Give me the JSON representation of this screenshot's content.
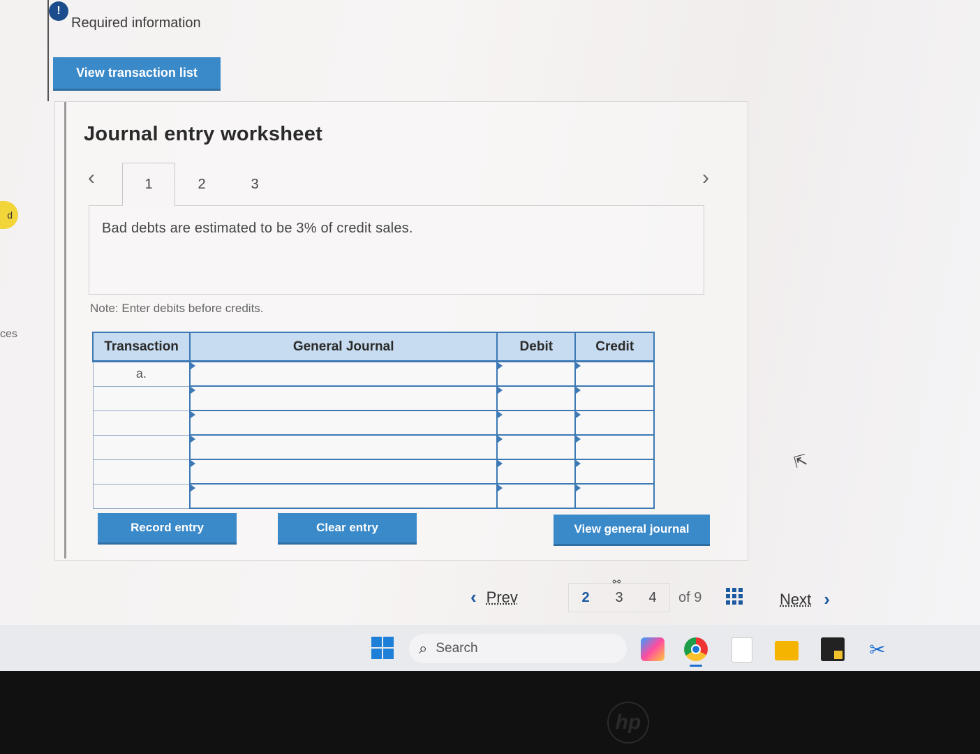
{
  "header": {
    "required_icon": "!",
    "required_text": "Required information",
    "view_transaction_list": "View transaction list"
  },
  "left_edge": {
    "badge": "d",
    "text": "ces"
  },
  "worksheet": {
    "title": "Journal entry worksheet",
    "tabs": [
      {
        "label": "1",
        "active": true
      },
      {
        "label": "2",
        "active": false
      },
      {
        "label": "3",
        "active": false
      }
    ],
    "description": "Bad debts are estimated to be 3% of credit sales.",
    "note": "Note: Enter debits before credits."
  },
  "journal": {
    "headers": [
      "Transaction",
      "General Journal",
      "Debit",
      "Credit"
    ],
    "rows": [
      {
        "transaction": "a.",
        "account": "",
        "debit": "",
        "credit": ""
      },
      {
        "transaction": "",
        "account": "",
        "debit": "",
        "credit": ""
      },
      {
        "transaction": "",
        "account": "",
        "debit": "",
        "credit": ""
      },
      {
        "transaction": "",
        "account": "",
        "debit": "",
        "credit": ""
      },
      {
        "transaction": "",
        "account": "",
        "debit": "",
        "credit": ""
      },
      {
        "transaction": "",
        "account": "",
        "debit": "",
        "credit": ""
      }
    ]
  },
  "actions": {
    "record": "Record entry",
    "clear": "Clear entry",
    "view_journal": "View general journal"
  },
  "pager": {
    "prev": "Prev",
    "pages": [
      "2",
      "3",
      "4"
    ],
    "current": "2",
    "of_total": "of 9",
    "next": "Next"
  },
  "taskbar": {
    "search_placeholder": "Search"
  },
  "icons": {
    "chevron_left": "‹",
    "chevron_right": "›",
    "search": "⌕",
    "link": "⚯",
    "pointer": "⇱",
    "hp": "hp"
  },
  "colors": {
    "accent_blue": "#3a89c9",
    "table_header": "#c7dcf0",
    "table_border": "#3c79b5",
    "link_blue": "#1c5aa0"
  }
}
